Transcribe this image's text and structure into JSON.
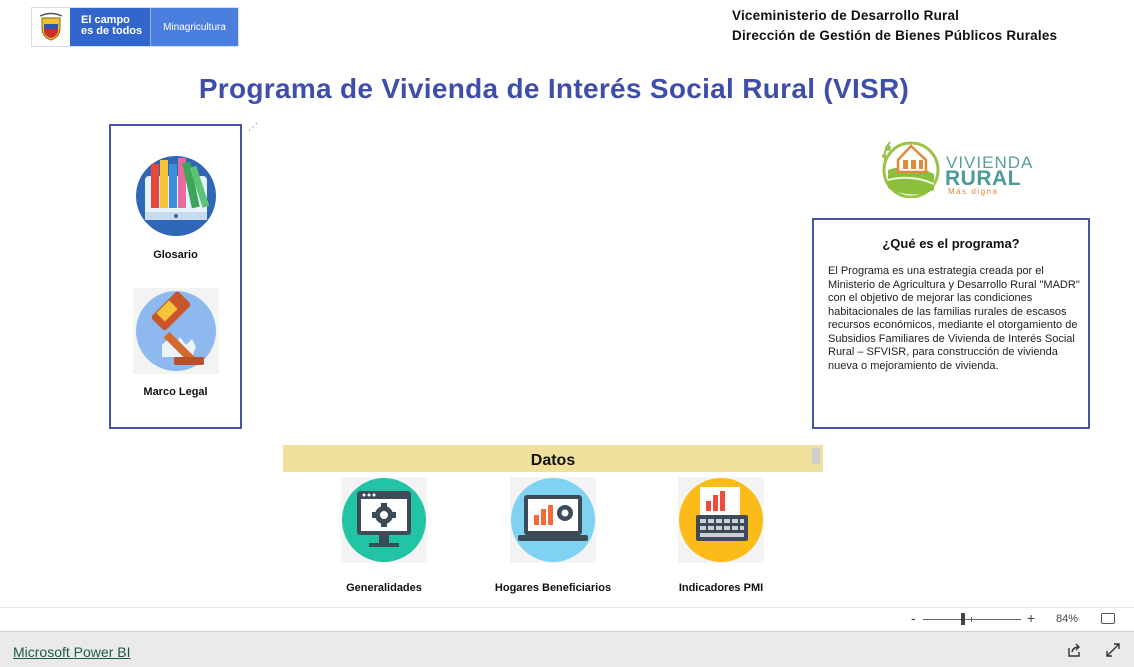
{
  "header": {
    "campo_line1": "El campo",
    "campo_line2": "es de todos",
    "ministry": "Minagricultura",
    "vice_line1": "Viceministerio de Desarrollo Rural",
    "vice_line2": "Dirección de Gestión de Bienes Públicos Rurales"
  },
  "title": "Programa de Vivienda de Interés Social Rural (VISR)",
  "left_nav": {
    "items": [
      {
        "label": "Glosario",
        "icon": "books-monitor-icon"
      },
      {
        "label": "Marco Legal",
        "icon": "gavel-icon"
      }
    ]
  },
  "vr_logo": {
    "word1": "VIVIENDA",
    "word2": "RURAL",
    "tagline": "Más digna"
  },
  "info": {
    "title": "¿Qué es el programa?",
    "body": "El Programa es una estrategia creada por el Ministerio de Agricultura y Desarrollo Rural \"MADR\" con el objetivo de mejorar las condiciones habitacionales de las familias rurales de escasos recursos económicos, mediante el otorgamiento de Subsidios Familiares de Vivienda de Interés Social Rural – SFVISR, para construcción de vivienda nueva o mejoramiento de vivienda."
  },
  "datos": {
    "title": "Datos",
    "items": [
      {
        "label": "Generalidades",
        "icon": "monitor-gear-icon"
      },
      {
        "label": "Hogares Beneficiarios",
        "icon": "laptop-chart-icon"
      },
      {
        "label": "Indicadores PMI",
        "icon": "keyboard-chart-icon"
      }
    ]
  },
  "zoom": {
    "minus": "-",
    "plus": "+",
    "percent": "84%",
    "level": 0.84
  },
  "footer": {
    "brand": "Microsoft Power BI"
  },
  "colors": {
    "title": "#3f4fa9",
    "panel_border": "#4a54a5",
    "datos_bar": "#efe09b",
    "gov_blue": "#3366cc"
  }
}
